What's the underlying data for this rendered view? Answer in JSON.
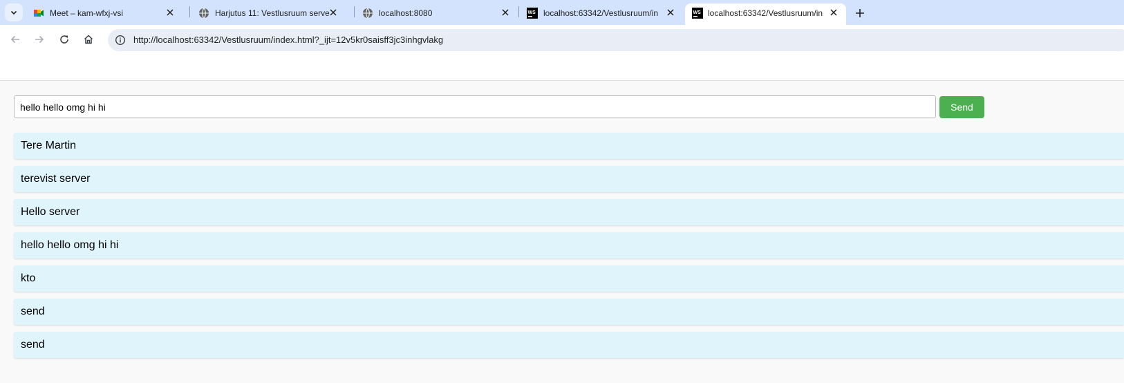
{
  "browser": {
    "tabs": [
      {
        "title": "Meet – kam-wfxj-vsi",
        "icon": "google-meet-icon"
      },
      {
        "title": "Harjutus 11: Vestlusruum server",
        "icon": "globe-icon"
      },
      {
        "title": "localhost:8080",
        "icon": "globe-icon"
      },
      {
        "title": "localhost:63342/Vestlusruum/in",
        "icon": "webstorm-icon"
      },
      {
        "title": "localhost:63342/Vestlusruum/in",
        "icon": "webstorm-icon"
      }
    ],
    "active_tab_index": 4,
    "address": "http://localhost:63342/Vestlusruum/index.html?_ijt=12v5kr0saisff3jc3inhgvlakg"
  },
  "chat": {
    "input_value": "hello hello omg hi hi",
    "send_label": "Send",
    "button_color": "#4caf50",
    "message_bg": "#e0f4fc",
    "messages": [
      "Tere Martin",
      "terevist server",
      "Hello server",
      "hello hello omg hi hi",
      "kto",
      "send",
      "send"
    ]
  }
}
